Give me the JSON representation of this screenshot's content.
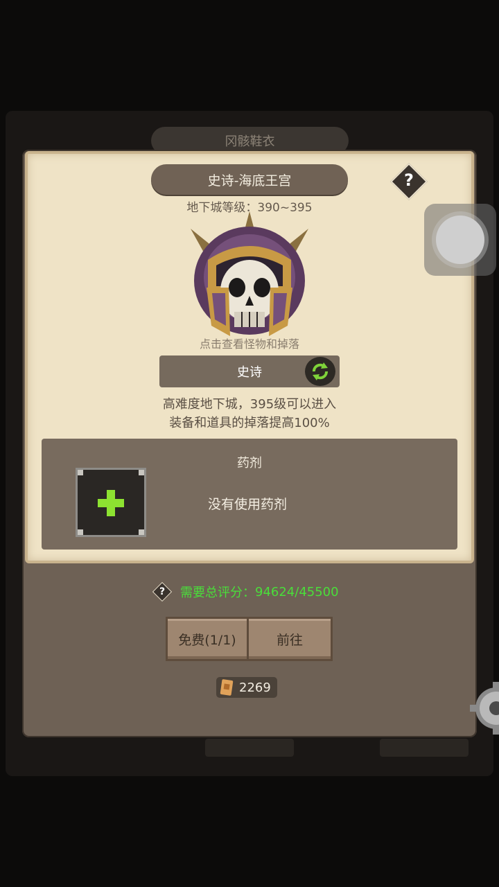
{
  "background": {
    "tab_label": "冈骸鞋衣"
  },
  "dungeon": {
    "title": "史诗-海底王宫",
    "level_text": "地下城等级：390~395",
    "hint": "点击查看怪物和掉落",
    "difficulty": "史诗",
    "desc_line1": "高难度地下城，395级可以进入",
    "desc_line2": "装备和道具的掉落提高100%",
    "help": "?"
  },
  "potion": {
    "title": "药剂",
    "empty_text": "没有使用药剂",
    "add_icon": "plus-icon"
  },
  "requirement": {
    "label": "需要总评分：",
    "value": "94624/45500",
    "help": "?"
  },
  "buttons": {
    "free_label": "免费(1/1)",
    "go_label": "前往"
  },
  "tickets": {
    "count": "2269"
  },
  "colors": {
    "parchment": "#efe3c6",
    "panel": "#6e6155",
    "score_green": "#4ade3a",
    "plus_green": "#8de231"
  }
}
